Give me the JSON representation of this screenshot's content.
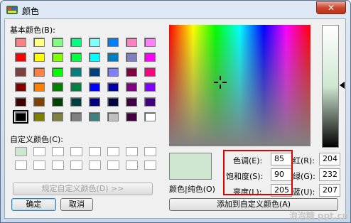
{
  "window": {
    "title": "颜色",
    "close_glyph": "✕"
  },
  "basic": {
    "label": "基本颜色(B):",
    "colors": [
      [
        "#ff8080",
        "#ffff80",
        "#80ff80",
        "#00ff80",
        "#80ffff",
        "#0080ff",
        "#ff80c0",
        "#ff80ff"
      ],
      [
        "#ff0000",
        "#ffff00",
        "#80ff00",
        "#00ff40",
        "#00ffff",
        "#0080c0",
        "#8080c0",
        "#ff00ff"
      ],
      [
        "#804040",
        "#ff8040",
        "#00ff00",
        "#008080",
        "#004080",
        "#8080ff",
        "#800040",
        "#ff0080"
      ],
      [
        "#800000",
        "#ff8000",
        "#008000",
        "#008040",
        "#0000ff",
        "#0000a0",
        "#800080",
        "#8000ff"
      ],
      [
        "#400000",
        "#804000",
        "#004000",
        "#004040",
        "#000080",
        "#000040",
        "#400040",
        "#400080"
      ],
      [
        "#000000",
        "#808000",
        "#808040",
        "#808080",
        "#408080",
        "#c0c0c0",
        "#400040",
        "#ffffff"
      ]
    ]
  },
  "custom": {
    "label": "自定义颜色(C):",
    "colors": [
      [
        "#cfe7d1",
        "#ffffff",
        "#ffffff",
        "#ffffff",
        "#ffffff",
        "#ffffff",
        "#ffffff",
        "#ffffff"
      ],
      [
        "#ffffff",
        "#ffffff",
        "#ffffff",
        "#ffffff",
        "#ffffff",
        "#ffffff",
        "#ffffff",
        "#ffffff"
      ]
    ]
  },
  "buttons": {
    "define_custom": "规定自定义颜色(D) >>",
    "ok": "确定",
    "cancel": "取消",
    "add_custom": "添加到自定义颜色(A)"
  },
  "preview": {
    "label": "颜色|纯色(O)",
    "color": "#cfe7d1"
  },
  "hsl": {
    "hue_label": "色调(E):",
    "hue": "85",
    "sat_label": "饱和度(S):",
    "sat": "90",
    "lum_label": "亮度(L):",
    "lum": "205"
  },
  "rgb": {
    "red_label": "红(R):",
    "red": "204",
    "green_label": "绿(G):",
    "green": "232",
    "blue_label": "蓝(U):",
    "blue": "207"
  },
  "watermark": "泡泡糖 ppt.cn"
}
